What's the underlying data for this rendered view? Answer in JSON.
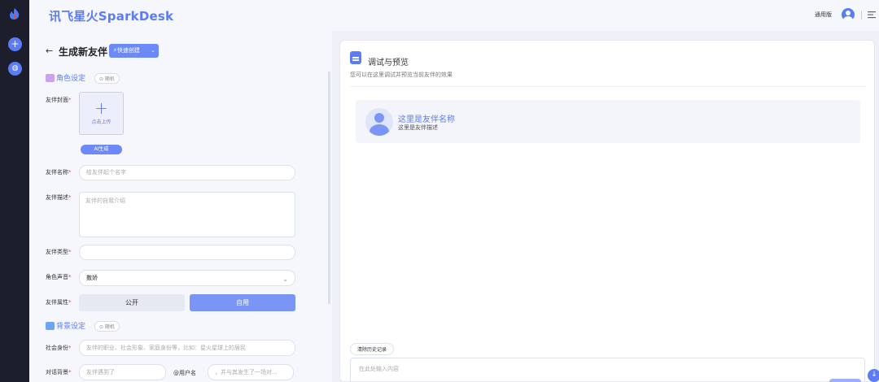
{
  "app": {
    "brand": "讯飞星火SparkDesk",
    "version_label": "通用版"
  },
  "colors": {
    "accent": "#5b7cf6",
    "required": "#e8474c",
    "rail": "#1c1f2b"
  },
  "rail": {
    "new_icon": "plus-icon",
    "history_icon": "drop-icon"
  },
  "header": {
    "back_icon": "back-arrow-icon",
    "title": "生成新友伴",
    "quick_create": "⚡快速创建"
  },
  "role_section": {
    "title": "角色设定",
    "random": "⊙ 随机",
    "cover_label": "友伴封面",
    "upload_text": "点击上传",
    "ai_button": "AI生成",
    "name_label": "友伴名称",
    "name_placeholder": "给友伴起个名字",
    "desc_label": "友伴描述",
    "desc_placeholder": "友伴的自我介绍",
    "type_label": "友伴类型",
    "type_value": "",
    "voice_label": "角色声音",
    "voice_value": "撒娇",
    "attr_label": "友伴属性",
    "attr_public": "公开",
    "attr_private": "自用"
  },
  "background_section": {
    "title": "背景设定",
    "random": "⊙ 随机",
    "identity_label": "社会身份",
    "identity_placeholder": "友伴的职业、社会形象、家庭身份等，比如：星火星球上的居民",
    "dialog_label": "对话背景",
    "dialog_placeholder": "友伴遇到了",
    "username_label": "@用户名",
    "event_placeholder": "，并与其发生了一场对..."
  },
  "preview": {
    "title": "调试与预览",
    "subtitle": "您可以在这里调试并预览当前友伴的效果",
    "card_name": "这里是友伴名称",
    "card_desc": "这里是友伴描述",
    "clear_history": "清除历史记录",
    "input_placeholder": "在此处输入内容"
  }
}
